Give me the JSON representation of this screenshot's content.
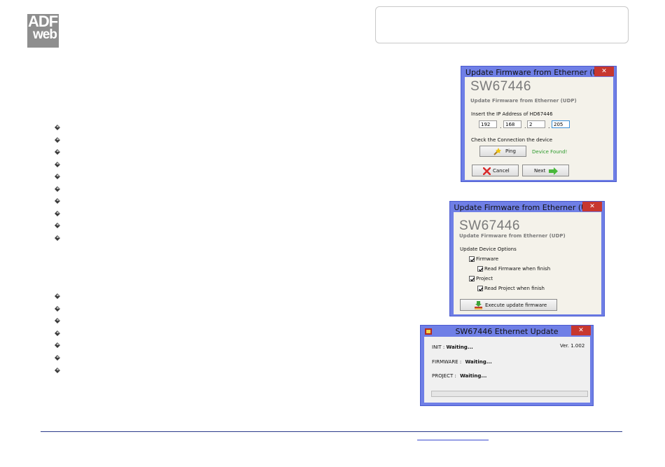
{
  "logo": {
    "line1": "ADF",
    "line2": "web"
  },
  "bullets": {
    "group_a_count": 10,
    "group_b_count": 7
  },
  "dialog_ip": {
    "title": "Update Firmware from Etherner (UDP)",
    "close": "✕",
    "product": "SW67446",
    "subtitle": "Update Firmware from Etherner (UDP)",
    "ip_label": "Insert the IP Address of HD67446",
    "ip": [
      "192",
      "168",
      "2",
      "205"
    ],
    "check_label": "Check the Connection the device",
    "ping_label": "Ping",
    "status": "Device Found!",
    "cancel_label": "Cancel",
    "next_label": "Next"
  },
  "dialog_options": {
    "title": "Update Firmware from Etherner (UDP)",
    "close": "✕",
    "product": "SW67446",
    "subtitle": "Update Firmware from Etherner (UDP)",
    "options_label": "Update Device Options",
    "firmware_label": "Firmware",
    "read_firmware_label": "Read Firmware when finish",
    "project_label": "Project",
    "read_project_label": "Read Project when finish",
    "execute_label": "Execute update firmware",
    "firmware_checked": true,
    "read_firmware_checked": true,
    "project_checked": true,
    "read_project_checked": true
  },
  "dialog_eth": {
    "title": "SW67446 Ethernet Update",
    "close": "✕",
    "version": "Ver. 1.002",
    "init_label": "INIT :",
    "init_value": "Waiting...",
    "firmware_label": "FIRMWARE :",
    "firmware_value": "Waiting...",
    "project_label": "PROJECT :",
    "project_value": "Waiting...",
    "progress": 0
  },
  "colors": {
    "title_bar": "#6f7fe6",
    "close": "#c7372f",
    "status_ok": "#2c9a2c",
    "footer_line": "#2a3a8a"
  }
}
